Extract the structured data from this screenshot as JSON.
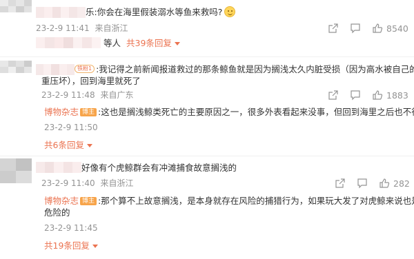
{
  "comments": [
    {
      "text_suffix": "乐:你会在海里假装溺水等鱼来救吗?",
      "date": "23-2-9 11:41",
      "location": "来自浙江",
      "likes": "8540",
      "more_text": "等人",
      "more_link": "共39条回复"
    },
    {
      "fan_badge": "铁粉1",
      "text_line1": ":我记得之前新闻报道救过的那条鲸鱼就是因为搁浅太久内脏受损（因为高水被自己的体",
      "text_line2": "重压坏），回到海里就死了",
      "date": "23-2-9 11:48",
      "location": "来自广东",
      "likes": "1883",
      "reply": {
        "author": "博物杂志",
        "badge": "博主",
        "text": ":这也是搁浅鲸类死亡的主要原因之一，很多外表看起来没事，但回到海里之后也不行了",
        "date": "23-2-9 11:50"
      },
      "more_link": "共6条回复"
    },
    {
      "text_suffix": "好像有个虎鲸群会有冲滩捕食故意搁浅的",
      "date": "23-2-9 11:40",
      "location": "来自浙江",
      "likes": "282",
      "reply": {
        "author": "博物杂志",
        "badge": "博主",
        "text_line1": ":那个算不上故意搁浅，是本身就存在风险的捕猎行为，如果玩大发了对虎鲸来说也是很",
        "text_line2": "危险的",
        "date": "23-2-9 11:45"
      },
      "more_link": "共19条回复"
    }
  ]
}
